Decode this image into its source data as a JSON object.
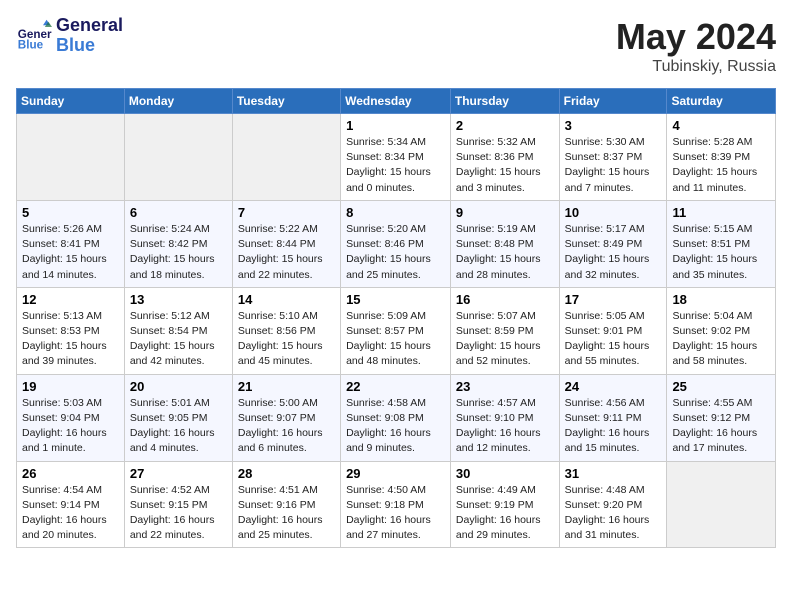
{
  "header": {
    "logo_line1": "General",
    "logo_line2": "Blue",
    "month": "May 2024",
    "location": "Tubinskiy, Russia"
  },
  "weekdays": [
    "Sunday",
    "Monday",
    "Tuesday",
    "Wednesday",
    "Thursday",
    "Friday",
    "Saturday"
  ],
  "weeks": [
    [
      {
        "day": "",
        "info": ""
      },
      {
        "day": "",
        "info": ""
      },
      {
        "day": "",
        "info": ""
      },
      {
        "day": "1",
        "info": "Sunrise: 5:34 AM\nSunset: 8:34 PM\nDaylight: 15 hours\nand 0 minutes."
      },
      {
        "day": "2",
        "info": "Sunrise: 5:32 AM\nSunset: 8:36 PM\nDaylight: 15 hours\nand 3 minutes."
      },
      {
        "day": "3",
        "info": "Sunrise: 5:30 AM\nSunset: 8:37 PM\nDaylight: 15 hours\nand 7 minutes."
      },
      {
        "day": "4",
        "info": "Sunrise: 5:28 AM\nSunset: 8:39 PM\nDaylight: 15 hours\nand 11 minutes."
      }
    ],
    [
      {
        "day": "5",
        "info": "Sunrise: 5:26 AM\nSunset: 8:41 PM\nDaylight: 15 hours\nand 14 minutes."
      },
      {
        "day": "6",
        "info": "Sunrise: 5:24 AM\nSunset: 8:42 PM\nDaylight: 15 hours\nand 18 minutes."
      },
      {
        "day": "7",
        "info": "Sunrise: 5:22 AM\nSunset: 8:44 PM\nDaylight: 15 hours\nand 22 minutes."
      },
      {
        "day": "8",
        "info": "Sunrise: 5:20 AM\nSunset: 8:46 PM\nDaylight: 15 hours\nand 25 minutes."
      },
      {
        "day": "9",
        "info": "Sunrise: 5:19 AM\nSunset: 8:48 PM\nDaylight: 15 hours\nand 28 minutes."
      },
      {
        "day": "10",
        "info": "Sunrise: 5:17 AM\nSunset: 8:49 PM\nDaylight: 15 hours\nand 32 minutes."
      },
      {
        "day": "11",
        "info": "Sunrise: 5:15 AM\nSunset: 8:51 PM\nDaylight: 15 hours\nand 35 minutes."
      }
    ],
    [
      {
        "day": "12",
        "info": "Sunrise: 5:13 AM\nSunset: 8:53 PM\nDaylight: 15 hours\nand 39 minutes."
      },
      {
        "day": "13",
        "info": "Sunrise: 5:12 AM\nSunset: 8:54 PM\nDaylight: 15 hours\nand 42 minutes."
      },
      {
        "day": "14",
        "info": "Sunrise: 5:10 AM\nSunset: 8:56 PM\nDaylight: 15 hours\nand 45 minutes."
      },
      {
        "day": "15",
        "info": "Sunrise: 5:09 AM\nSunset: 8:57 PM\nDaylight: 15 hours\nand 48 minutes."
      },
      {
        "day": "16",
        "info": "Sunrise: 5:07 AM\nSunset: 8:59 PM\nDaylight: 15 hours\nand 52 minutes."
      },
      {
        "day": "17",
        "info": "Sunrise: 5:05 AM\nSunset: 9:01 PM\nDaylight: 15 hours\nand 55 minutes."
      },
      {
        "day": "18",
        "info": "Sunrise: 5:04 AM\nSunset: 9:02 PM\nDaylight: 15 hours\nand 58 minutes."
      }
    ],
    [
      {
        "day": "19",
        "info": "Sunrise: 5:03 AM\nSunset: 9:04 PM\nDaylight: 16 hours\nand 1 minute."
      },
      {
        "day": "20",
        "info": "Sunrise: 5:01 AM\nSunset: 9:05 PM\nDaylight: 16 hours\nand 4 minutes."
      },
      {
        "day": "21",
        "info": "Sunrise: 5:00 AM\nSunset: 9:07 PM\nDaylight: 16 hours\nand 6 minutes."
      },
      {
        "day": "22",
        "info": "Sunrise: 4:58 AM\nSunset: 9:08 PM\nDaylight: 16 hours\nand 9 minutes."
      },
      {
        "day": "23",
        "info": "Sunrise: 4:57 AM\nSunset: 9:10 PM\nDaylight: 16 hours\nand 12 minutes."
      },
      {
        "day": "24",
        "info": "Sunrise: 4:56 AM\nSunset: 9:11 PM\nDaylight: 16 hours\nand 15 minutes."
      },
      {
        "day": "25",
        "info": "Sunrise: 4:55 AM\nSunset: 9:12 PM\nDaylight: 16 hours\nand 17 minutes."
      }
    ],
    [
      {
        "day": "26",
        "info": "Sunrise: 4:54 AM\nSunset: 9:14 PM\nDaylight: 16 hours\nand 20 minutes."
      },
      {
        "day": "27",
        "info": "Sunrise: 4:52 AM\nSunset: 9:15 PM\nDaylight: 16 hours\nand 22 minutes."
      },
      {
        "day": "28",
        "info": "Sunrise: 4:51 AM\nSunset: 9:16 PM\nDaylight: 16 hours\nand 25 minutes."
      },
      {
        "day": "29",
        "info": "Sunrise: 4:50 AM\nSunset: 9:18 PM\nDaylight: 16 hours\nand 27 minutes."
      },
      {
        "day": "30",
        "info": "Sunrise: 4:49 AM\nSunset: 9:19 PM\nDaylight: 16 hours\nand 29 minutes."
      },
      {
        "day": "31",
        "info": "Sunrise: 4:48 AM\nSunset: 9:20 PM\nDaylight: 16 hours\nand 31 minutes."
      },
      {
        "day": "",
        "info": ""
      }
    ]
  ]
}
